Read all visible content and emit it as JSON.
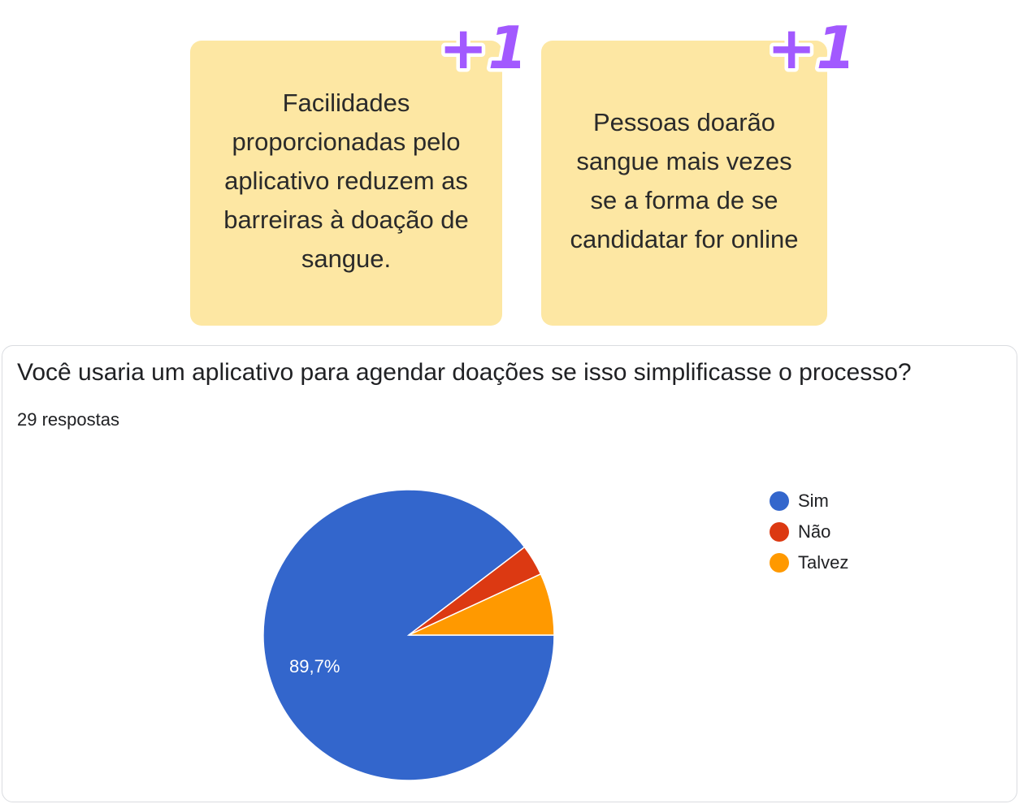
{
  "notes": [
    {
      "text": "Facilidades proporcionadas pelo aplicativo reduzem as barreiras à doação de sangue.",
      "badge": "+1"
    },
    {
      "text": "Pessoas doarão sangue mais vezes se a forma de se candidatar for online",
      "badge": "+1"
    }
  ],
  "colors": {
    "note_background": "#fde7a3",
    "badge_purple": "#a259ff",
    "sim": "#3366cc",
    "nao": "#dc3912",
    "talvez": "#ff9900"
  },
  "card": {
    "question": "Você usaria um aplicativo para agendar doações se isso simplificasse o processo?",
    "responses": "29 respostas"
  },
  "chart_data": {
    "type": "pie",
    "total_responses": 29,
    "slices": [
      {
        "label": "Sim",
        "value": 26,
        "percent_label": "89,7%",
        "color": "#3366cc"
      },
      {
        "label": "Não",
        "value": 1,
        "percent_label": "",
        "color": "#dc3912"
      },
      {
        "label": "Talvez",
        "value": 2,
        "percent_label": "",
        "color": "#ff9900"
      }
    ],
    "legend_position": "right"
  }
}
